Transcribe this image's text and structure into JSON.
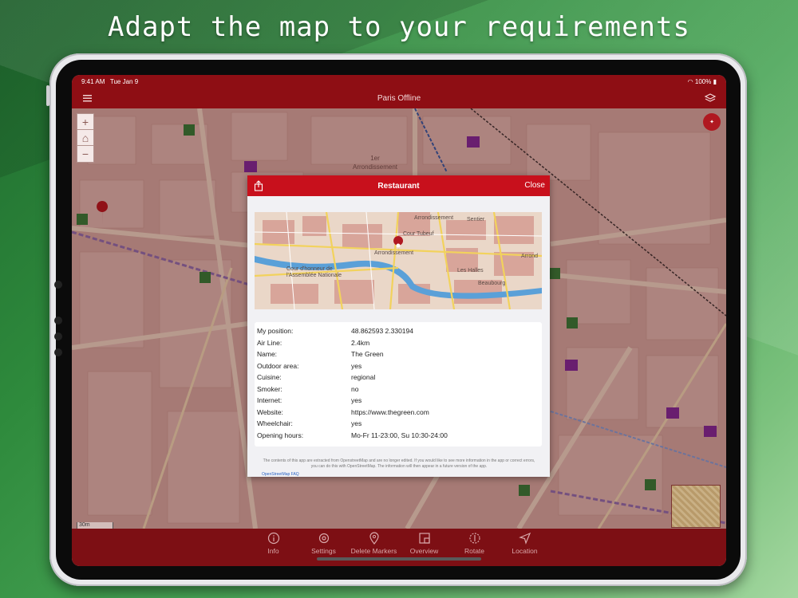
{
  "headline": "Adapt the map to your requirements",
  "status": {
    "time": "9:41 AM",
    "date": "Tue Jan 9",
    "battery": "100%"
  },
  "navbar": {
    "title": "Paris Offline"
  },
  "map": {
    "labels": {
      "district": "1er\nArrondissement"
    },
    "scale": "30m",
    "zoom": {
      "in": "+",
      "out": "−"
    }
  },
  "modal": {
    "title": "Restaurant",
    "close_label": "Close",
    "preview_labels": [
      "Arrondissement",
      "Sentier",
      "Cour Tubeuf",
      "Arrondissement",
      "Arrond",
      "Cour d'honneur de l'Assemblée Nationale",
      "Les Halles",
      "Beaubourg"
    ],
    "rows": [
      {
        "key": "My position:",
        "value": "48.862593 2.330194"
      },
      {
        "key": "Air Line:",
        "value": "2.4km"
      },
      {
        "key": "Name:",
        "value": "The Green"
      },
      {
        "key": "Outdoor area:",
        "value": "yes"
      },
      {
        "key": "Cuisine:",
        "value": "regional"
      },
      {
        "key": "Smoker:",
        "value": "no"
      },
      {
        "key": "Internet:",
        "value": "yes"
      },
      {
        "key": "Website:",
        "value": "https://www.thegreen.com"
      },
      {
        "key": "Wheelchair:",
        "value": "yes"
      },
      {
        "key": "Opening hours:",
        "value": "Mo-Fr 11-23:00, Su 10:30-24:00"
      }
    ],
    "disclaimer": "The contents of this app are extracted from OpenstreetMap and are no longer edited. If you would like to see more information in the app or correct errors, you can do this with OpenStreetMap. The information will then appear in a future version of the app.",
    "faq_link": "OpenStreetMap FAQ"
  },
  "tabs": [
    {
      "label": "Info",
      "icon": "info-icon"
    },
    {
      "label": "Settings",
      "icon": "gear-icon"
    },
    {
      "label": "Delete Markers",
      "icon": "pin-icon"
    },
    {
      "label": "Overview",
      "icon": "overview-icon"
    },
    {
      "label": "Rotate",
      "icon": "rotate-icon"
    },
    {
      "label": "Location",
      "icon": "location-arrow-icon"
    }
  ],
  "colors": {
    "accent": "#c8101c",
    "bar": "#8e0e14",
    "tabbar": "#7d0f14"
  }
}
